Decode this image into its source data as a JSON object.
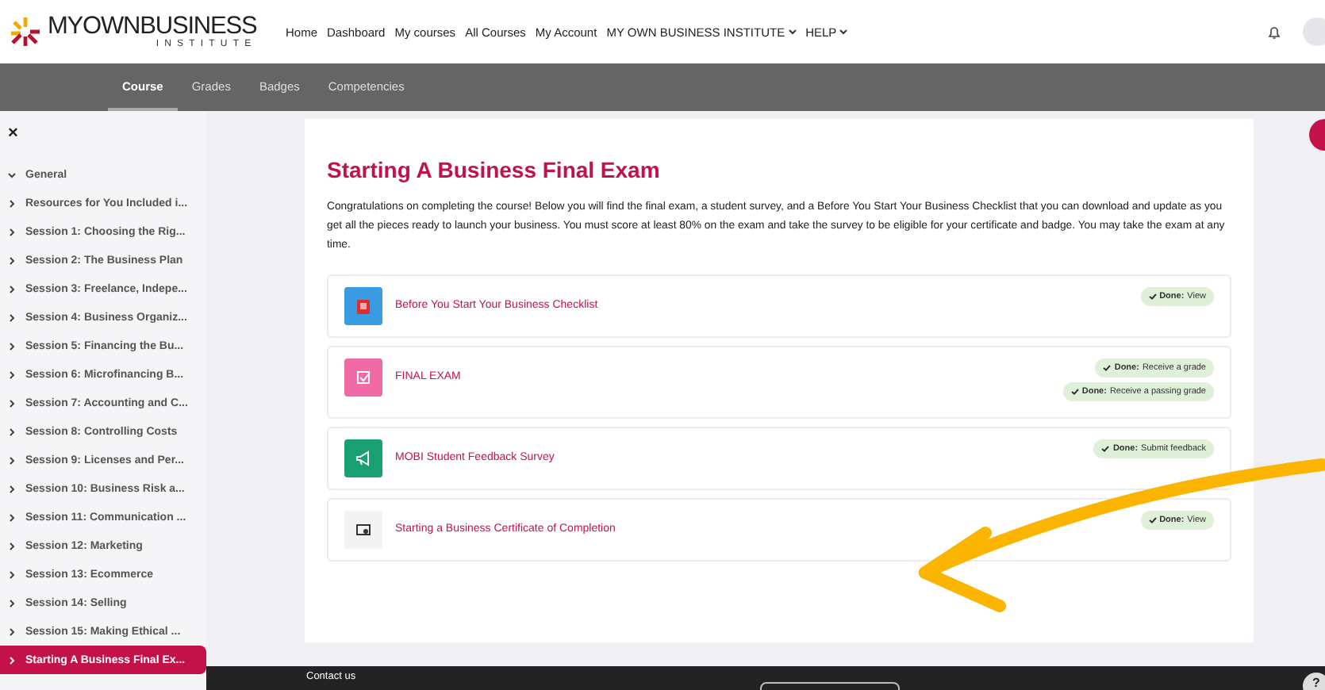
{
  "header": {
    "logo_text": "MYOWNBUSINESS",
    "logo_sub": "INSTITUTE",
    "nav": [
      {
        "label": "Home",
        "dropdown": false
      },
      {
        "label": "Dashboard",
        "dropdown": false
      },
      {
        "label": "My courses",
        "dropdown": false
      },
      {
        "label": "All Courses",
        "dropdown": false
      },
      {
        "label": "My Account",
        "dropdown": false
      },
      {
        "label": "MY OWN BUSINESS INSTITUTE",
        "dropdown": true
      },
      {
        "label": "HELP",
        "dropdown": true
      }
    ]
  },
  "tabs": [
    {
      "label": "Course",
      "selected": true
    },
    {
      "label": "Grades",
      "selected": false
    },
    {
      "label": "Badges",
      "selected": false
    },
    {
      "label": "Competencies",
      "selected": false
    }
  ],
  "sidebar": {
    "close": "×",
    "items": [
      {
        "label": "General",
        "expanded": true,
        "selected": false
      },
      {
        "label": "Resources for You Included i...",
        "expanded": false,
        "selected": false
      },
      {
        "label": "Session 1: Choosing the Rig...",
        "expanded": false,
        "selected": false
      },
      {
        "label": "Session 2: The Business Plan",
        "expanded": false,
        "selected": false
      },
      {
        "label": "Session 3: Freelance, Indepe...",
        "expanded": false,
        "selected": false
      },
      {
        "label": "Session 4: Business Organiz...",
        "expanded": false,
        "selected": false
      },
      {
        "label": "Session 5: Financing the Bu...",
        "expanded": false,
        "selected": false
      },
      {
        "label": "Session 6: Microfinancing B...",
        "expanded": false,
        "selected": false
      },
      {
        "label": "Session 7: Accounting and C...",
        "expanded": false,
        "selected": false
      },
      {
        "label": "Session 8: Controlling Costs",
        "expanded": false,
        "selected": false
      },
      {
        "label": "Session 9: Licenses and Per...",
        "expanded": false,
        "selected": false
      },
      {
        "label": "Session 10: Business Risk a...",
        "expanded": false,
        "selected": false
      },
      {
        "label": "Session 11: Communication ...",
        "expanded": false,
        "selected": false
      },
      {
        "label": "Session 12: Marketing",
        "expanded": false,
        "selected": false
      },
      {
        "label": "Session 13: Ecommerce",
        "expanded": false,
        "selected": false
      },
      {
        "label": "Session 14: Selling",
        "expanded": false,
        "selected": false
      },
      {
        "label": "Session 15: Making Ethical ...",
        "expanded": false,
        "selected": false
      },
      {
        "label": "Starting A Business Final Ex...",
        "expanded": false,
        "selected": true
      }
    ]
  },
  "section": {
    "title": "Starting A Business Final Exam",
    "intro": "Congratulations on completing the course! Below you will find the final exam, a student survey, and a Before You Start Your Business Checklist that you can download and update as you get all the pieces ready to launch your business. You must score at least 80% on the exam and take the survey to be eligible for your certificate and badge. You may take the exam at any time.",
    "activities": [
      {
        "kind": "resource",
        "name": "Before You Start Your Business Checklist",
        "completions": [
          {
            "label": "Done:",
            "text": "View"
          }
        ]
      },
      {
        "kind": "quiz",
        "name": "FINAL EXAM",
        "completions": [
          {
            "label": "Done:",
            "text": "Receive a grade"
          },
          {
            "label": "Done:",
            "text": "Receive a passing grade"
          }
        ]
      },
      {
        "kind": "feedback",
        "name": "MOBI Student Feedback Survey",
        "completions": [
          {
            "label": "Done:",
            "text": "Submit feedback"
          }
        ]
      },
      {
        "kind": "certificate",
        "name": "Starting a Business Certificate of Completion",
        "completions": [
          {
            "label": "Done:",
            "text": "View"
          }
        ]
      }
    ]
  },
  "footer": {
    "contact": "Contact us"
  },
  "help_button": "?"
}
